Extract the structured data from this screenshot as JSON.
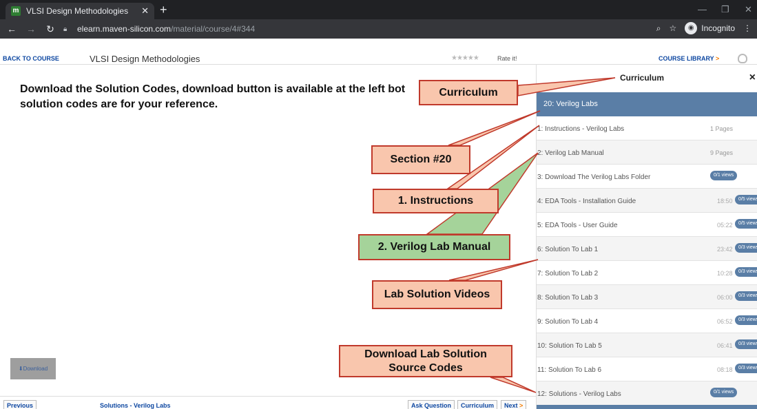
{
  "browser": {
    "tab_title": "VLSI Design Methodologies",
    "tab_icon_letter": "m",
    "new_tab": "+",
    "url_domain": "elearn.maven-silicon.com",
    "url_path": "/material/course/4#344",
    "incognito_label": "Incognito"
  },
  "header": {
    "back_label": "BACK TO COURSE",
    "course_title": "VLSI Design Methodologies",
    "stars": "★★★★★",
    "rate_label": "Rate it!",
    "library_label": "COURSE LIBRARY",
    "library_arrow": ">"
  },
  "main": {
    "heading": "Download the Solution Codes, download button is available at the left bot ... solution codes are for your reference.",
    "heading_line1": "Download the Solution Codes, download button is available at the left bot",
    "heading_line2": "solution codes are for your reference.",
    "download_label": "Download"
  },
  "sidebar": {
    "title": "Curriculum",
    "close": "×",
    "section": "20: Verilog Labs",
    "items": [
      {
        "label": "1: Instructions - Verilog Labs",
        "meta": "1 Pages",
        "views": ""
      },
      {
        "label": "2: Verilog Lab Manual",
        "meta": "9 Pages",
        "views": ""
      },
      {
        "label": "3: Download The Verilog Labs Folder",
        "meta": "",
        "views": "0/1 views"
      },
      {
        "label": "4: EDA Tools - Installation Guide",
        "meta": "18:50",
        "views": "0/5 views"
      },
      {
        "label": "5: EDA Tools - User Guide",
        "meta": "05:22",
        "views": "0/5 views"
      },
      {
        "label": "6: Solution To Lab 1",
        "meta": "23:42",
        "views": "0/3 views"
      },
      {
        "label": "7: Solution To Lab 2",
        "meta": "10:28",
        "views": "0/3 views"
      },
      {
        "label": "8: Solution To Lab 3",
        "meta": "06:00",
        "views": "0/3 views"
      },
      {
        "label": "9: Solution To Lab 4",
        "meta": "06:52",
        "views": "0/3 views"
      },
      {
        "label": "10: Solution To Lab 5",
        "meta": "06:41",
        "views": "0/3 views"
      },
      {
        "label": "11: Solution To Lab 6",
        "meta": "08:18",
        "views": "0/3 views"
      },
      {
        "label": "12: Solutions - Verilog Labs",
        "meta": "",
        "views": "0/1 views"
      }
    ]
  },
  "footer": {
    "previous": "Previous",
    "center": "Solutions - Verilog Labs",
    "ask": "Ask Question",
    "curriculum": "Curriculum",
    "next": "Next",
    "next_arrow": ">"
  },
  "annotations": {
    "curriculum": "Curriculum",
    "section": "Section #20",
    "instructions": "1. Instructions",
    "manual": "2. Verilog Lab Manual",
    "videos": "Lab Solution Videos",
    "download_line1": "Download Lab Solution",
    "download_line2": "Source Codes"
  },
  "colors": {
    "section_bg": "#5a7ea6",
    "callout_bg": "#f9c6ad",
    "callout_green": "#a5d39a",
    "callout_border": "#c0392b",
    "link_blue": "#0d47a1"
  }
}
